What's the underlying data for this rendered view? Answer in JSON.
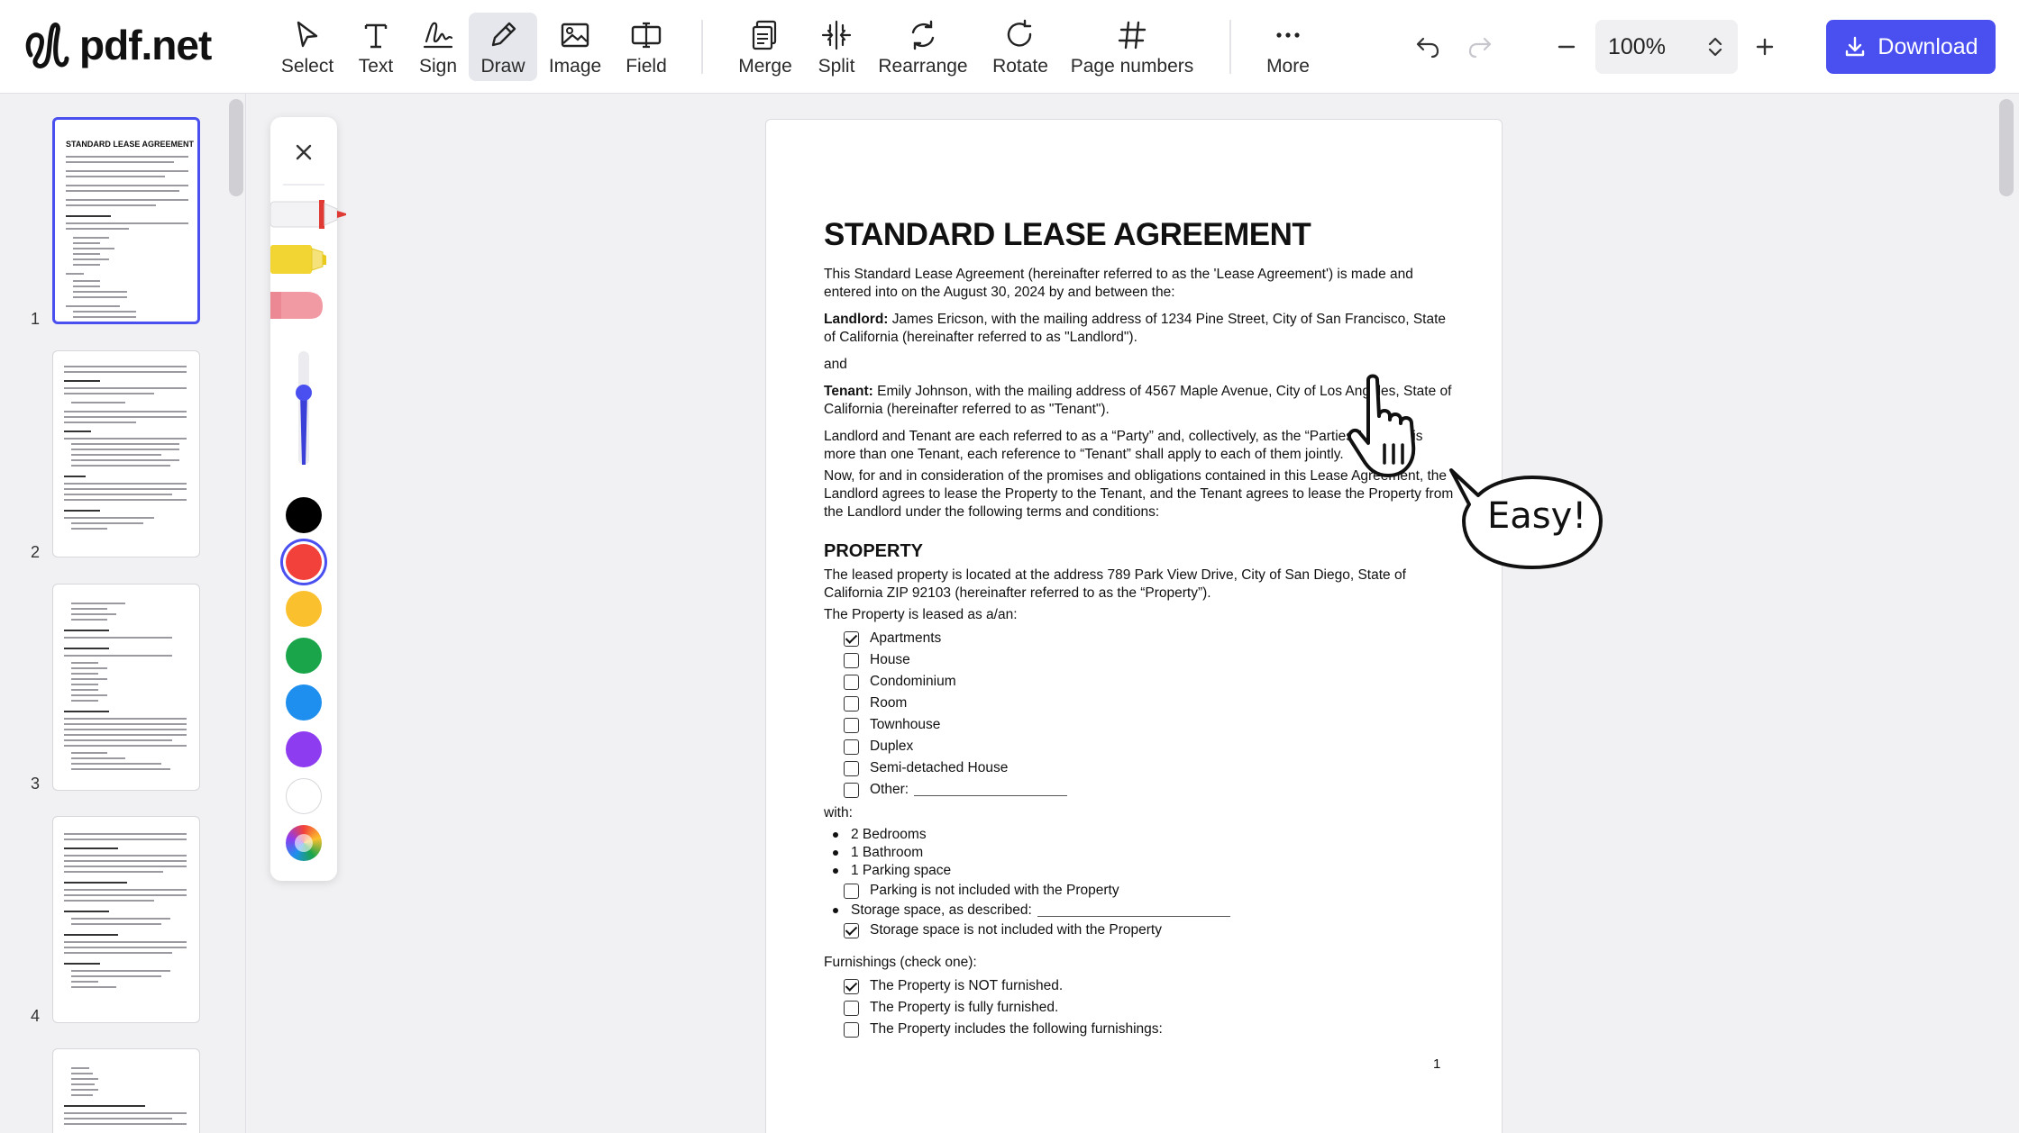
{
  "app": {
    "name": "pdf.net"
  },
  "toolbar": {
    "tools": [
      {
        "label": "Select",
        "icon": "cursor-icon"
      },
      {
        "label": "Text",
        "icon": "text-icon"
      },
      {
        "label": "Sign",
        "icon": "signature-icon"
      },
      {
        "label": "Draw",
        "icon": "pencil-icon",
        "active": true
      },
      {
        "label": "Image",
        "icon": "image-icon"
      },
      {
        "label": "Field",
        "icon": "field-icon"
      }
    ],
    "page_tools": [
      {
        "label": "Merge",
        "icon": "merge-icon"
      },
      {
        "label": "Split",
        "icon": "split-icon"
      },
      {
        "label": "Rearrange",
        "icon": "rearrange-icon"
      },
      {
        "label": "Rotate",
        "icon": "rotate-icon"
      },
      {
        "label": "Page numbers",
        "icon": "hash-icon"
      }
    ],
    "more_label": "More",
    "zoom_value": "100%",
    "download_label": "Download",
    "accent": "#4a4ff0"
  },
  "thumbnails": {
    "pages": [
      "1",
      "2",
      "3",
      "4"
    ],
    "selected": "1",
    "page1_title": "STANDARD LEASE AGREEMENT"
  },
  "palette": {
    "colors": [
      "#000000",
      "#f2413b",
      "#fbc02d",
      "#1aa54a",
      "#1e8fee",
      "#8e3cf0",
      "#ffffff"
    ],
    "selected_color": "#f2413b"
  },
  "document": {
    "title": "STANDARD LEASE AGREEMENT",
    "intro": "This Standard Lease Agreement (hereinafter referred to as the 'Lease Agreement') is made and entered into on the August 30, 2024 by and between the:",
    "landlord_label": "Landlord:",
    "landlord_text": " James Ericson, with the mailing address of 1234 Pine Street, City of San Francisco, State of California (hereinafter referred to as \"Landlord\").",
    "and": "and",
    "tenant_label": "Tenant:",
    "tenant_text": " Emily Johnson, with the mailing address of 4567 Maple Avenue, City of Los Angeles, State of California (hereinafter referred to as \"Tenant\").",
    "party_text": "Landlord and Tenant are each referred to as a “Party” and, collectively, as the “Parties.” If there is more than one Tenant, each reference to “Tenant” shall apply to each of them jointly.",
    "consideration": "Now, for and in consideration of the promises and obligations contained in this Lease Agreement, the Landlord agrees to lease the Property to the Tenant, and the Tenant agrees to lease the Property from the Landlord under the following terms and conditions:",
    "property_heading": "PROPERTY",
    "property_address": "The leased property is located at the address 789 Park View Drive, City of San Diego, State of California ZIP 92103 (hereinafter referred to as the “Property”).",
    "leased_as": "The Property is leased as a/an:",
    "property_types": [
      {
        "label": "Apartments",
        "checked": true
      },
      {
        "label": "House",
        "checked": false
      },
      {
        "label": "Condominium",
        "checked": false
      },
      {
        "label": "Room",
        "checked": false
      },
      {
        "label": "Townhouse",
        "checked": false
      },
      {
        "label": "Duplex",
        "checked": false
      },
      {
        "label": "Semi-detached House",
        "checked": false
      },
      {
        "label": "Other:",
        "checked": false
      }
    ],
    "with_label": "with:",
    "bullets": [
      "2 Bedrooms",
      "1 Bathroom",
      "1 Parking space"
    ],
    "parking_note": "Parking is not included with the Property",
    "storage_label": "Storage space, as described:",
    "storage_note": "Storage space is not included with the Property",
    "furnishings_label": "Furnishings (check one):",
    "furnishings": [
      {
        "label": "The Property is NOT furnished.",
        "checked": true
      },
      {
        "label": "The Property is fully furnished.",
        "checked": false
      },
      {
        "label": "The Property includes the following furnishings:",
        "checked": false
      }
    ],
    "page_number": "1"
  },
  "overlay": {
    "bubble_text": "Easy!"
  }
}
